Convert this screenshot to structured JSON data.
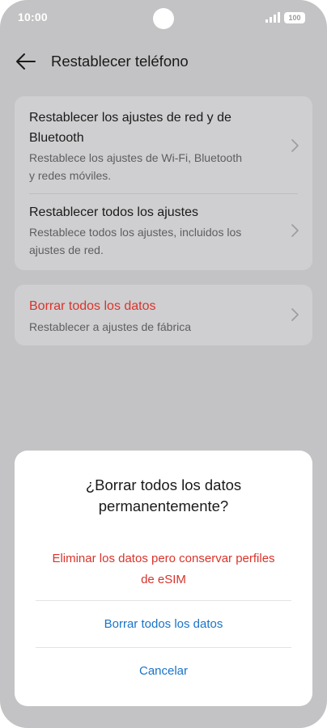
{
  "status_bar": {
    "time": "10:00",
    "battery": "100"
  },
  "header": {
    "title": "Restablecer teléfono"
  },
  "settings": {
    "network_reset": {
      "title_line1": "Restablecer los ajustes de red y de",
      "title_line2": "Bluetooth",
      "sub_line1": "Restablece los ajustes de Wi-Fi, Bluetooth",
      "sub_line2": "y redes móviles."
    },
    "all_reset": {
      "title": "Restablecer todos los ajustes",
      "sub_line1": "Restablece todos los ajustes, incluidos los",
      "sub_line2": "ajustes de red."
    },
    "erase": {
      "title": "Borrar todos los datos",
      "sub": "Restablecer a ajustes de fábrica"
    }
  },
  "dialog": {
    "title_line1": "¿Borrar todos los datos",
    "title_line2": "permanentemente?",
    "option_keep_esim_line1": "Eliminar los datos pero conservar perfiles",
    "option_keep_esim_line2": "de eSIM",
    "option_erase_all": "Borrar todos los datos",
    "option_cancel": "Cancelar"
  },
  "colors": {
    "danger": "#d9342b",
    "accent": "#1a73c8",
    "scrim_background": "#c3c3c5"
  },
  "icons": {
    "back": "arrow-left-icon",
    "chevron": "chevron-right-icon",
    "signal": "signal-icon",
    "battery": "battery-icon"
  }
}
